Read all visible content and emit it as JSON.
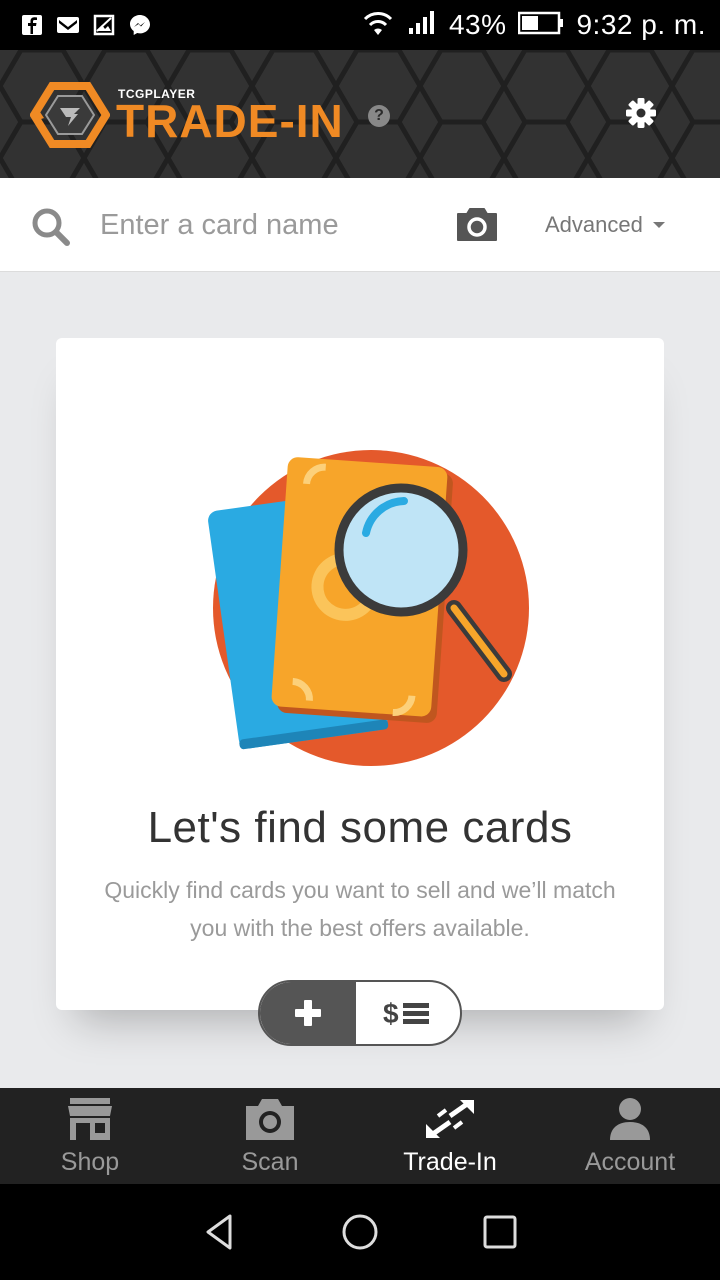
{
  "status_bar": {
    "battery": "43%",
    "time": "9:32 p. m.",
    "notification_icons": [
      "facebook-icon",
      "gmail-icon",
      "gallery-icon",
      "messenger-icon"
    ]
  },
  "header": {
    "brand_small": "TCGPLAYER",
    "brand_big": "TRADE-IN",
    "help": "?",
    "accent_color": "#f08a24"
  },
  "search": {
    "placeholder": "Enter a card name",
    "advanced_label": "Advanced"
  },
  "empty_state": {
    "title": "Let's find some cards",
    "description": "Quickly find cards you want to sell and we’ll match you with the best offers available."
  },
  "toggle": {
    "add_label": "+",
    "list_label": "$☰"
  },
  "bottom_nav": {
    "items": [
      {
        "label": "Shop",
        "icon": "store-icon"
      },
      {
        "label": "Scan",
        "icon": "camera-icon"
      },
      {
        "label": "Trade-In",
        "icon": "trade-arrows-icon",
        "active": true
      },
      {
        "label": "Account",
        "icon": "user-icon"
      }
    ]
  }
}
